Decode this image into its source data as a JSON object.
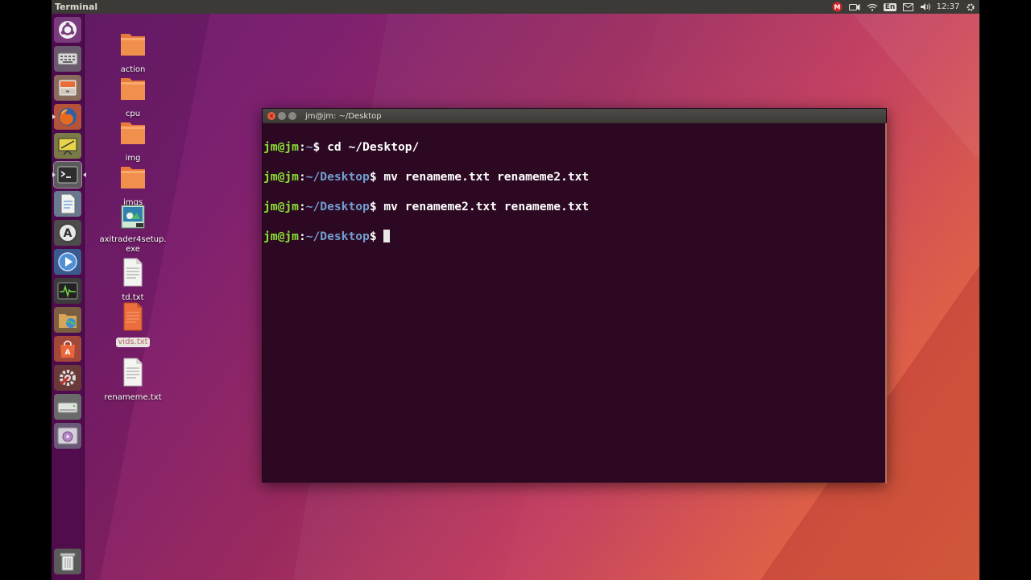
{
  "panel": {
    "title": "Terminal",
    "keyboard_layout": "En",
    "clock": "12:37",
    "badge_letter": "M"
  },
  "launcher": {
    "items": [
      {
        "name": "dash-home",
        "icon": "ubuntu-logo-icon"
      },
      {
        "name": "keyboard",
        "icon": "keyboard-icon"
      },
      {
        "name": "files",
        "icon": "file-cabinet-icon"
      },
      {
        "name": "firefox",
        "icon": "firefox-icon"
      },
      {
        "name": "presentation",
        "icon": "easel-icon"
      },
      {
        "name": "terminal",
        "icon": "terminal-icon"
      },
      {
        "name": "text-editor",
        "icon": "document-icon"
      },
      {
        "name": "software-updater",
        "icon": "software-updater-icon"
      },
      {
        "name": "media-player",
        "icon": "play-icon"
      },
      {
        "name": "system-monitor",
        "icon": "monitor-icon"
      },
      {
        "name": "file-browser",
        "icon": "folder-globe-icon"
      },
      {
        "name": "software-center",
        "icon": "shopping-bag-icon"
      },
      {
        "name": "system-settings",
        "icon": "gear-wrench-icon"
      },
      {
        "name": "drive",
        "icon": "drive-icon"
      },
      {
        "name": "disc",
        "icon": "disc-icon"
      },
      {
        "name": "trash",
        "icon": "trash-icon"
      }
    ]
  },
  "desktop": {
    "icons": [
      {
        "label": "action",
        "type": "folder"
      },
      {
        "label": "cpu",
        "type": "folder"
      },
      {
        "label": "img",
        "type": "folder"
      },
      {
        "label": "imgs",
        "type": "folder"
      },
      {
        "label": "axitrader4setup.\nexe",
        "type": "exe"
      },
      {
        "label": "td.txt",
        "type": "text"
      },
      {
        "label": "vids.txt",
        "type": "text-orange"
      },
      {
        "label": "renameme.txt",
        "type": "text"
      }
    ]
  },
  "terminal": {
    "title": "jm@jm: ~/Desktop",
    "lines": [
      {
        "user": "jm@jm",
        "path": "~",
        "cmd": " cd ~/Desktop/"
      },
      {
        "user": "jm@jm",
        "path": "~/Desktop",
        "cmd": " mv renameme.txt renameme2.txt"
      },
      {
        "user": "jm@jm",
        "path": "~/Desktop",
        "cmd": " mv renameme2.txt renameme.txt"
      },
      {
        "user": "jm@jm",
        "path": "~/Desktop",
        "cmd": ""
      }
    ]
  },
  "colors": {
    "prompt_user": "#8ae234",
    "prompt_path": "#729fcf",
    "terminal_bg": "#2c0822",
    "panel_bg": "#3b3a36"
  }
}
